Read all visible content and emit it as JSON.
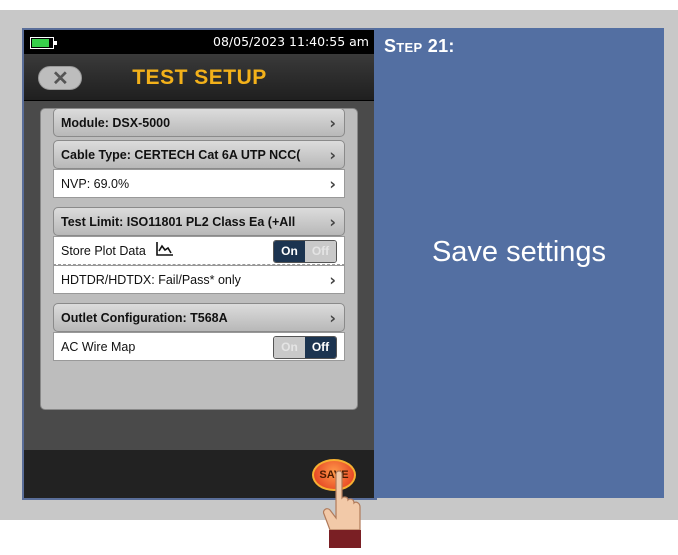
{
  "statusbar": {
    "battery_icon": "battery-icon",
    "datetime": "08/05/2023 11:40:55 am"
  },
  "header": {
    "back_icon": "close-x-icon",
    "title": "TEST SETUP"
  },
  "settings": {
    "module": "Module: DSX-5000",
    "cable_type": "Cable Type: CERTECH Cat 6A UTP NCC(",
    "nvp": "NVP: 69.0%",
    "test_limit": "Test Limit: ISO11801 PL2 Class Ea (+All",
    "store_plot": {
      "label": "Store Plot Data",
      "on": "On",
      "off": "Off",
      "value": "On"
    },
    "hdtdr": "HDTDR/HDTDX: Fail/Pass* only",
    "outlet": "Outlet Configuration: T568A",
    "ac_wire_map": {
      "label": "AC Wire Map",
      "on": "On",
      "off": "Off",
      "value": "Off"
    }
  },
  "footer": {
    "save_label": "SAVE"
  },
  "side_panel": {
    "step": "Step 21:",
    "instruction": "Save settings"
  },
  "colors": {
    "title": "#f3b11a",
    "side_panel": "#536fa2",
    "toggle_active": "#1c3450",
    "save_button": "#e0301a"
  }
}
